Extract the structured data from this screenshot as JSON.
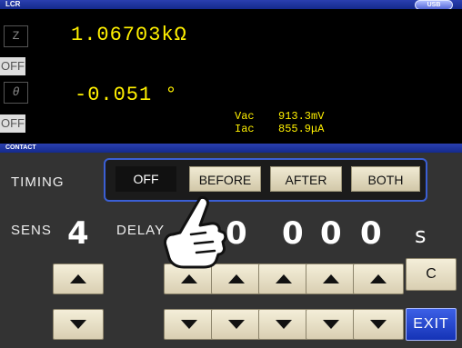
{
  "window": {
    "title": "LCR",
    "usb_label": "USB"
  },
  "measurement": {
    "param1_symbol": "Z",
    "param1_value": "1.06703kΩ",
    "param2_symbol": "OFF",
    "param3_symbol": "θ",
    "param3_value": "-0.051 °",
    "param4_symbol": "OFF",
    "monitor_v_label": "Vac",
    "monitor_v_value": "913.3mV",
    "monitor_i_label": "Iac",
    "monitor_i_value": "855.9μA"
  },
  "section": {
    "title": "CONTACT"
  },
  "timing": {
    "label": "TIMING",
    "options": [
      "OFF",
      "BEFORE",
      "AFTER",
      "BOTH"
    ],
    "selected": "OFF"
  },
  "sens": {
    "label": "SENS",
    "value": "4"
  },
  "delay": {
    "label": "DELAY",
    "digits": [
      "0",
      "0",
      "0",
      "0",
      "0"
    ],
    "unit": "s"
  },
  "buttons": {
    "clear_label": "C",
    "exit_label": "EXIT"
  },
  "colors": {
    "accent": "#1f3bb0",
    "measurement_text": "#fff000",
    "key_face": "#e8e0c6"
  },
  "icons": {
    "up": "triangle-up-icon",
    "down": "triangle-down-icon",
    "pointer": "pointing-hand-icon"
  }
}
